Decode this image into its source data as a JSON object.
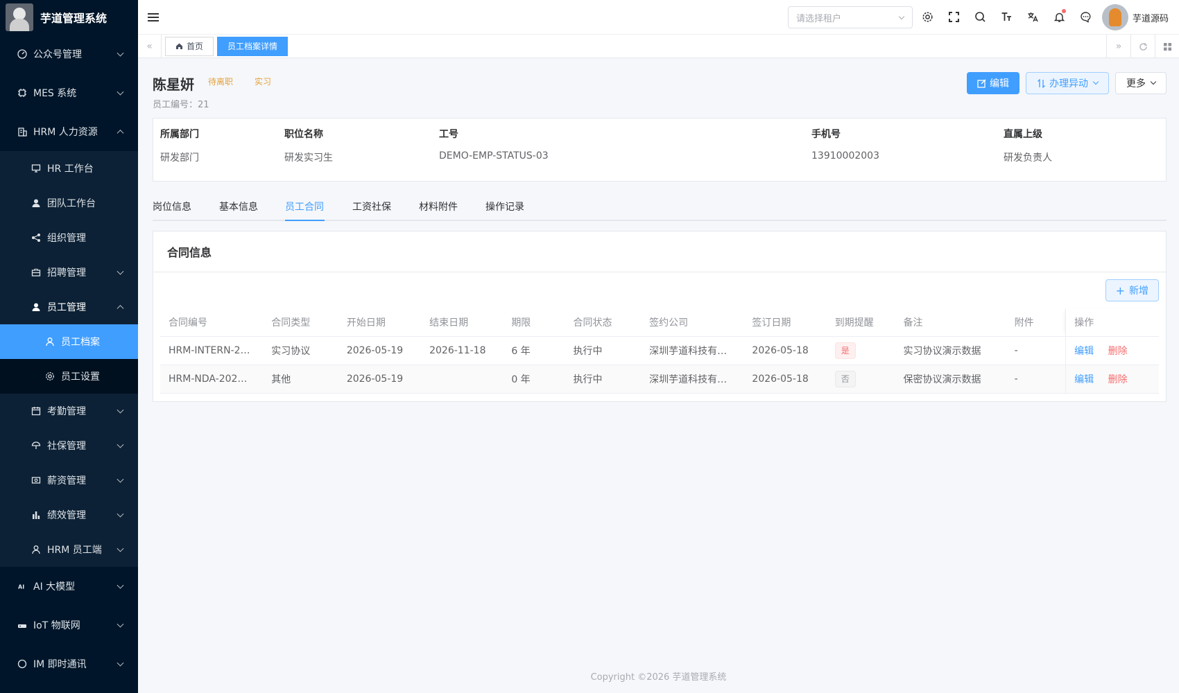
{
  "app": {
    "title": "芋道管理系统"
  },
  "sidebar": {
    "items": [
      {
        "label": "公众号管理",
        "icon": "dashboard-icon"
      },
      {
        "label": "MES 系统",
        "icon": "chip-icon"
      },
      {
        "label": "HRM 人力资源",
        "icon": "building-icon",
        "expanded": true
      }
    ],
    "hrm_sub": [
      {
        "label": "HR 工作台",
        "icon": "monitor-icon"
      },
      {
        "label": "团队工作台",
        "icon": "user-icon"
      },
      {
        "label": "组织管理",
        "icon": "share-icon"
      },
      {
        "label": "招聘管理",
        "icon": "briefcase-icon"
      },
      {
        "label": "员工管理",
        "icon": "user-icon",
        "expanded": true
      }
    ],
    "emp_sub": [
      {
        "label": "员工档案",
        "icon": "user-outline-icon",
        "active": true
      },
      {
        "label": "员工设置",
        "icon": "gear-icon"
      }
    ],
    "hrm_sub_rest": [
      {
        "label": "考勤管理",
        "icon": "calendar-icon"
      },
      {
        "label": "社保管理",
        "icon": "umbrella-icon"
      },
      {
        "label": "薪资管理",
        "icon": "money-icon"
      },
      {
        "label": "绩效管理",
        "icon": "bar-chart-icon"
      },
      {
        "label": "HRM 员工端",
        "icon": "user-outline-icon"
      }
    ],
    "tail_items": [
      {
        "label": "AI 大模型",
        "icon": "ai-icon"
      },
      {
        "label": "IoT 物联网",
        "icon": "router-icon"
      },
      {
        "label": "IM 即时通讯",
        "icon": "chat-icon"
      }
    ]
  },
  "navbar": {
    "tenant_placeholder": "请选择租户",
    "user_name": "芋道源码"
  },
  "tags": {
    "home": "首页",
    "current": "员工档案详情"
  },
  "employee": {
    "name": "陈星妍",
    "status_tags": [
      "待离职",
      "实习"
    ],
    "emp_no_label": "员工编号：",
    "emp_no": "21",
    "buttons": {
      "edit": "编辑",
      "change": "办理异动",
      "more": "更多"
    },
    "info": [
      {
        "label": "所属部门",
        "value": "研发部门"
      },
      {
        "label": "职位名称",
        "value": "研发实习生"
      },
      {
        "label": "工号",
        "value": "DEMO-EMP-STATUS-03"
      },
      {
        "label": "手机号",
        "value": "13910002003"
      },
      {
        "label": "直属上级",
        "value": "研发负责人"
      }
    ]
  },
  "tabs": [
    "岗位信息",
    "基本信息",
    "员工合同",
    "工资社保",
    "材料附件",
    "操作记录"
  ],
  "active_tab": "员工合同",
  "contract": {
    "title": "合同信息",
    "add_label": "新增",
    "columns": [
      "合同编号",
      "合同类型",
      "开始日期",
      "结束日期",
      "期限",
      "合同状态",
      "签约公司",
      "签订日期",
      "到期提醒",
      "备注",
      "附件",
      "操作"
    ],
    "rows": [
      {
        "no": "HRM-INTERN-2…",
        "type": "实习协议",
        "start": "2026-05-19",
        "end": "2026-11-18",
        "term": "6 年",
        "status": "执行中",
        "company": "深圳芋道科技有…",
        "sign_date": "2026-05-18",
        "remind": "是",
        "remark": "实习协议演示数据",
        "attach": "-",
        "edit": "编辑",
        "del": "删除"
      },
      {
        "no": "HRM-NDA-202…",
        "type": "其他",
        "start": "2026-05-19",
        "end": "",
        "term": "0 年",
        "status": "执行中",
        "company": "深圳芋道科技有…",
        "sign_date": "2026-05-18",
        "remind": "否",
        "remark": "保密协议演示数据",
        "attach": "-",
        "edit": "编辑",
        "del": "删除"
      }
    ]
  },
  "footer": "Copyright ©2026 芋道管理系统",
  "colors": {
    "primary": "#409eff",
    "sidebar_bg": "#001529",
    "danger": "#f56c6c",
    "warning": "#e6a23c"
  }
}
